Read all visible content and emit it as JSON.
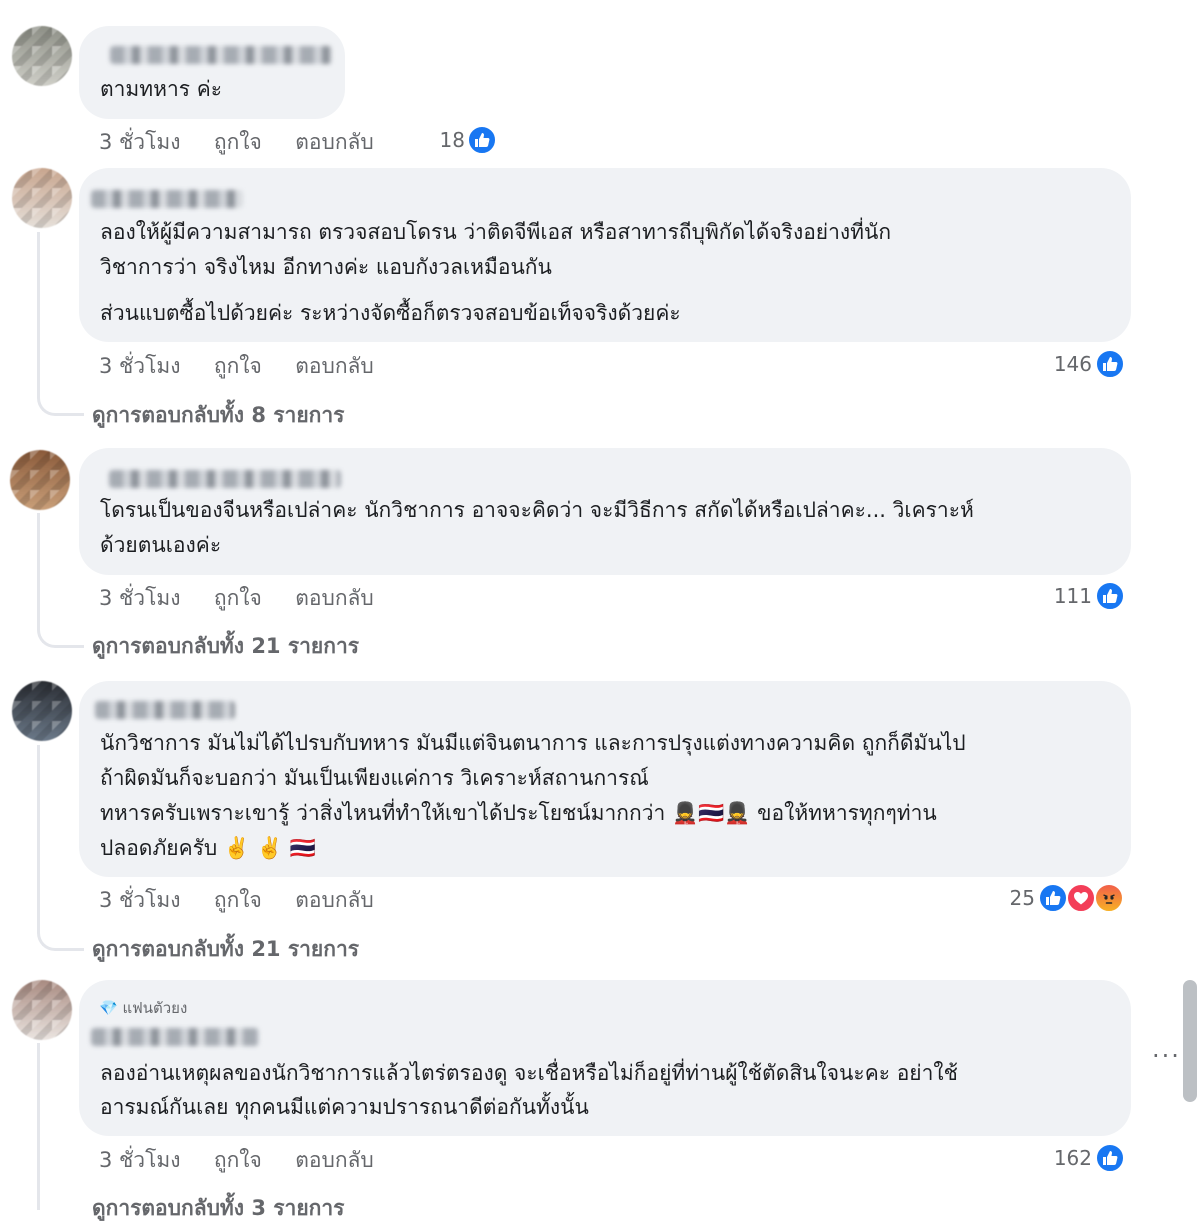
{
  "labels": {
    "time": "3 ชั่วโมง",
    "like": "ถูกใจ",
    "reply": "ตอบกลับ"
  },
  "comments": [
    {
      "lines": [
        "ตามทหาร ค่ะ"
      ],
      "reactions": "18",
      "reaction_icons": [
        "like-icon"
      ]
    },
    {
      "lines": [
        "ลองให้ผู้มีความสามารถ ตรวจสอบโดรน ว่าติดจีพีเอส หรือสาทารถีบุพิกัดได้จริงอย่างที่นัก",
        "วิชาการว่า จริงไหม อีกทางค่ะ แอบกังวลเหมือนกัน",
        "ส่วนแบตซื้อไปด้วยค่ะ ระหว่างจัดซื้อก็ตรวจสอบข้อเท็จจริงด้วยค่ะ"
      ],
      "reactions": "146",
      "reaction_icons": [
        "like-icon"
      ],
      "view_replies": "ดูการตอบกลับทั้ง 8 รายการ"
    },
    {
      "lines": [
        "โดรนเป็นของจีนหรือเปล่าคะ นักวิชาการ อาจจะคิดว่า จะมีวิธีการ สกัดได้หรือเปล่าคะ... วิเคราะห์",
        "ด้วยตนเองค่ะ"
      ],
      "reactions": "111",
      "reaction_icons": [
        "like-icon"
      ],
      "view_replies": "ดูการตอบกลับทั้ง 21 รายการ"
    },
    {
      "lines": [
        "นักวิชาการ มันไม่ได้ไปรบกับทหาร มันมีแต่จินตนาการ และการปรุงแต่งทางความคิด ถูกก็ดีมันไป",
        "ถ้าผิดมันก็จะบอกว่า มันเป็นเพียงแค่การ วิเคราะห์สถานการณ์",
        "ทหารครับเพราะเขารู้ ว่าสิ่งไหนที่ทำให้เขาได้ประโยชน์มากกว่า 💂🇹🇭💂 ขอให้ทหารทุกๆท่าน",
        "ปลอดภัยครับ ✌️ ✌️ 🇹🇭"
      ],
      "reactions": "25",
      "reaction_icons": [
        "like-icon",
        "love-icon",
        "angry-icon"
      ],
      "view_replies": "ดูการตอบกลับทั้ง 21 รายการ"
    },
    {
      "badge": "แฟนตัวยง",
      "lines": [
        "ลองอ่านเหตุผลของนักวิชาการแล้วไตร่ตรองดู จะเชื่อหรือไม่ก็อยู่ที่ท่านผู้ใช้ตัดสินใจนะคะ อย่าใช้",
        "อารมณ์กันเลย ทุกคนมีแต่ความปรารถนาดีต่อกันทั้งนั้น"
      ],
      "reactions": "162",
      "reaction_icons": [
        "like-icon"
      ],
      "view_replies": "ดูการตอบกลับทั้ง 3 รายการ"
    }
  ],
  "colors": {
    "bubble": "#f0f2f5",
    "meta_text": "#65676b",
    "like_blue": "#1877f2",
    "love_red": "#f33e58"
  }
}
